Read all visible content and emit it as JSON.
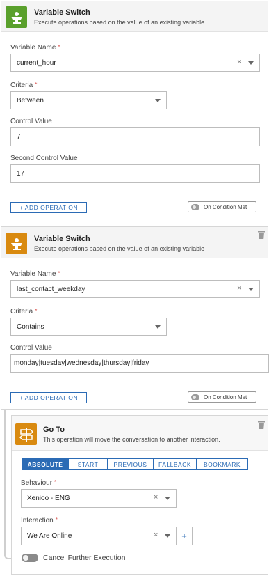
{
  "card1": {
    "title": "Variable Switch",
    "subtitle": "Execute operations based on the value of an existing variable",
    "icon": "variable-switch-icon",
    "icon_color": "#5aa02c",
    "variable_name_label": "Variable Name",
    "variable_name_value": "current_hour",
    "criteria_label": "Criteria",
    "criteria_value": "Between",
    "control_value_label": "Control Value",
    "control_value": "7",
    "second_control_value_label": "Second Control Value",
    "second_control_value": "17",
    "add_operation": "+ ADD OPERATION",
    "condition_met": "On Condition Met"
  },
  "card2": {
    "title": "Variable Switch",
    "subtitle": "Execute operations based on the value of an existing variable",
    "icon": "variable-switch-icon",
    "icon_color": "#d98a10",
    "variable_name_label": "Variable Name",
    "variable_name_value": "last_contact_weekday",
    "criteria_label": "Criteria",
    "criteria_value": "Contains",
    "control_value_label": "Control Value",
    "control_value": "monday|tuesday|wednesday|thursday|friday",
    "add_operation": "+ ADD OPERATION",
    "condition_met": "On Condition Met"
  },
  "card3": {
    "title": "Go To",
    "subtitle": "This operation will move the conversation to another interaction.",
    "icon": "signpost-icon",
    "icon_color": "#d98a10",
    "tabs": [
      "ABSOLUTE",
      "START",
      "PREVIOUS",
      "FALLBACK",
      "BOOKMARK"
    ],
    "active_tab": "ABSOLUTE",
    "behaviour_label": "Behaviour",
    "behaviour_value": "Xenioo - ENG",
    "interaction_label": "Interaction",
    "interaction_value": "We Are Online",
    "cancel_label": "Cancel Further Execution"
  },
  "required_marker": "*",
  "clear_glyph": "×"
}
